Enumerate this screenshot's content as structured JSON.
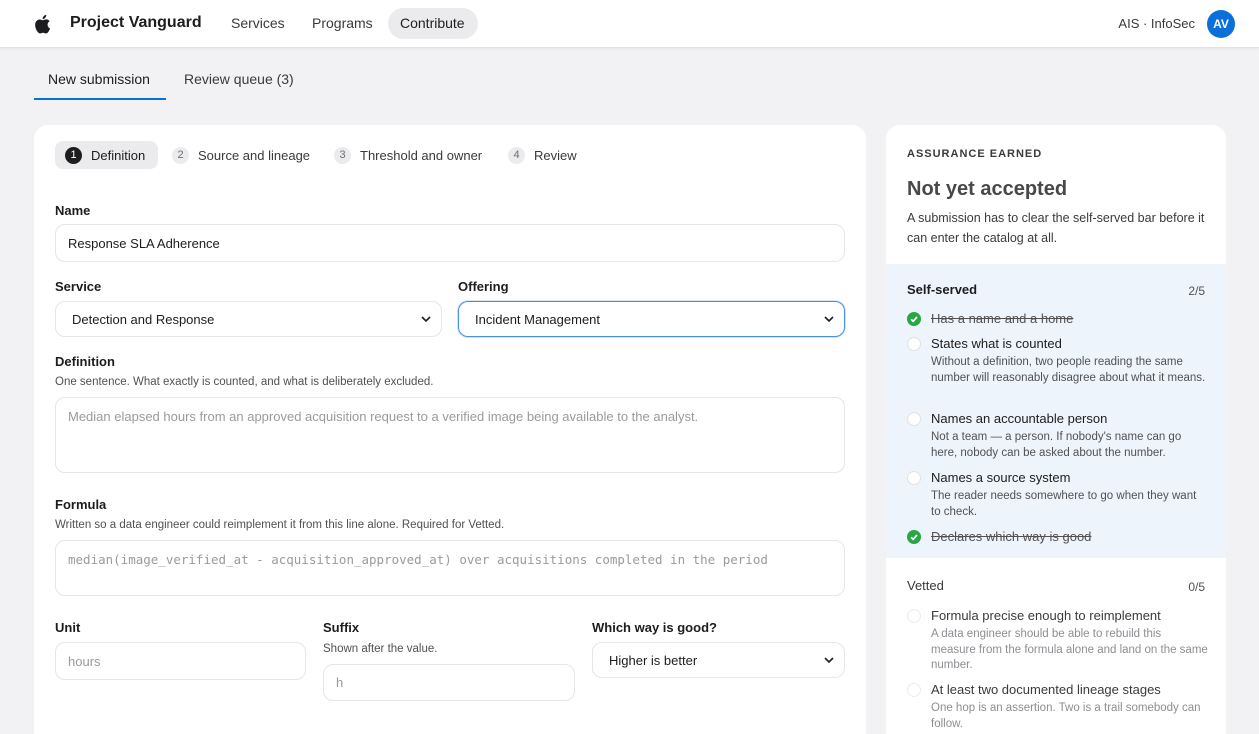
{
  "header": {
    "brand": "Project Vanguard",
    "nav": [
      {
        "label": "Services",
        "active": false
      },
      {
        "label": "Programs",
        "active": false
      },
      {
        "label": "Contribute",
        "active": true
      }
    ],
    "org": "AIS · InfoSec",
    "avatar_initials": "AV"
  },
  "page_tabs": [
    {
      "label": "New submission",
      "active": true
    },
    {
      "label": "Review queue (3)",
      "active": false
    }
  ],
  "steps": [
    {
      "num": "1",
      "label": "Definition",
      "active": true
    },
    {
      "num": "2",
      "label": "Source and lineage",
      "active": false
    },
    {
      "num": "3",
      "label": "Threshold and owner",
      "active": false
    },
    {
      "num": "4",
      "label": "Review",
      "active": false
    }
  ],
  "form": {
    "name": {
      "label": "Name",
      "value": "Response SLA Adherence"
    },
    "service": {
      "label": "Service",
      "value": "Detection and Response"
    },
    "offering": {
      "label": "Offering",
      "value": "Incident Management"
    },
    "definition": {
      "label": "Definition",
      "help": "One sentence. What exactly is counted, and what is deliberately excluded.",
      "placeholder": "Median elapsed hours from an approved acquisition request to a verified image being available to the analyst."
    },
    "formula": {
      "label": "Formula",
      "help": "Written so a data engineer could reimplement it from this line alone. Required for Vetted.",
      "placeholder": "median(image_verified_at - acquisition_approved_at) over acquisitions completed in the period"
    },
    "unit": {
      "label": "Unit",
      "placeholder": "hours"
    },
    "suffix": {
      "label": "Suffix",
      "help": "Shown after the value.",
      "placeholder": "h"
    },
    "direction": {
      "label": "Which way is good?",
      "value": "Higher is better"
    }
  },
  "assurance": {
    "eyebrow": "ASSURANCE EARNED",
    "title": "Not yet accepted",
    "description": "A submission has to clear the self-served bar before it can enter the catalog at all.",
    "groups": [
      {
        "title": "Self-served",
        "count": "2/5",
        "criteria": [
          {
            "title": "Has a name and a home",
            "done": true,
            "desc": ""
          },
          {
            "title": "States what is counted",
            "done": false,
            "desc": "Without a definition, two people reading the same number will reasonably disagree about what it means."
          },
          {
            "title": "Names an accountable person",
            "done": false,
            "desc": "Not a team — a person. If nobody's name can go here, nobody can be asked about the number."
          },
          {
            "title": "Names a source system",
            "done": false,
            "desc": "The reader needs somewhere to go when they want to check."
          },
          {
            "title": "Declares which way is good",
            "done": true,
            "desc": ""
          }
        ]
      },
      {
        "title": "Vetted",
        "count": "0/5",
        "criteria": [
          {
            "title": "Formula precise enough to reimplement",
            "done": false,
            "desc": "A data engineer should be able to rebuild this measure from the formula alone and land on the same number."
          },
          {
            "title": "At least two documented lineage stages",
            "done": false,
            "desc": "One hop is an assertion. Two is a trail somebody can follow."
          }
        ]
      }
    ]
  },
  "icons": {
    "logo": "apple-logo-icon",
    "chevron": "chevron-down-icon",
    "check": "check-icon"
  },
  "colors": {
    "accent": "#0a6fd8",
    "success": "#28a745",
    "focus": "#4a90e2"
  }
}
